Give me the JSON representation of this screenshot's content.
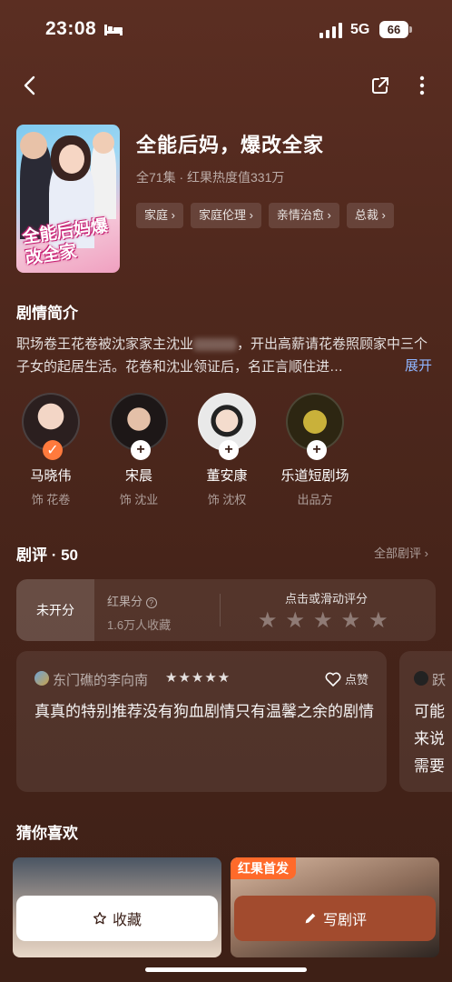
{
  "status_bar": {
    "time": "23:08",
    "network": "5G",
    "battery": "66"
  },
  "show": {
    "title": "全能后妈，爆改全家",
    "meta": "全71集 · 红果热度值331万",
    "poster_text": "全能后妈爆改全家",
    "tags": [
      "家庭 ›",
      "家庭伦理 ›",
      "亲情治愈 ›",
      "总裁 ›"
    ]
  },
  "synopsis": {
    "title": "剧情简介",
    "text": "职场卷王花卷被沈家家主沈业",
    "text_tail": "，开出高薪请花卷照顾家中三个子女的起居生活。花卷和沈业领证后，名正言顺住进…",
    "expand": "展开"
  },
  "cast": [
    {
      "name": "马晓伟",
      "role": "饰 花卷",
      "badge": "✓",
      "followed": true
    },
    {
      "name": "宋晨",
      "role": "饰 沈业",
      "badge": "+",
      "followed": false
    },
    {
      "name": "董安康",
      "role": "饰 沈权",
      "badge": "+",
      "followed": false
    },
    {
      "name": "乐道短剧场",
      "role": "出品方",
      "badge": "+",
      "followed": false
    }
  ],
  "reviews": {
    "title": "剧评 · 50",
    "all_link": "全部剧评 ›",
    "rating": {
      "status": "未开分",
      "label": "红果分",
      "count": "1.6万人收藏",
      "hint": "点击或滑动评分",
      "stars": [
        "★",
        "★",
        "★",
        "★",
        "★"
      ]
    },
    "items": [
      {
        "user": "东门礁的李向南",
        "stars": "★★★★★",
        "like": "点赞",
        "text": "真真的特别推荐没有狗血剧情只有温馨之余的剧情"
      },
      {
        "user": "跃",
        "line1": "可能",
        "line2": "来说",
        "line3": "需要"
      }
    ]
  },
  "recommend": {
    "title": "猜你喜欢",
    "badge": "红果首发"
  },
  "bottom_bar": {
    "favorite": "收藏",
    "write_review": "写剧评"
  }
}
